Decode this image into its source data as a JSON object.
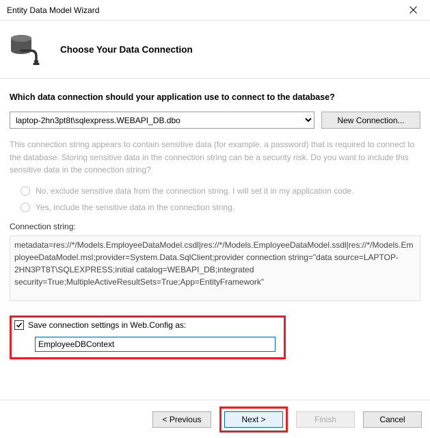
{
  "window": {
    "title": "Entity Data Model Wizard"
  },
  "header": {
    "title": "Choose Your Data Connection"
  },
  "prompt": "Which data connection should your application use to connect to the database?",
  "connection": {
    "selected": "laptop-2hn3pt8t\\sqlexpress.WEBAPI_DB.dbo",
    "new_button": "New Connection..."
  },
  "sensitive": {
    "explain": "This connection string appears to contain sensitive data (for example, a password) that is required to connect to the database. Storing sensitive data in the connection string can be a security risk. Do you want to include this sensitive data in the connection string?",
    "no_label": "No, exclude sensitive data from the connection string. I will set it in my application code.",
    "yes_label": "Yes, include the sensitive data in the connection string."
  },
  "connstring": {
    "label": "Connection string:",
    "value": "metadata=res://*/Models.EmployeeDataModel.csdl|res://*/Models.EmployeeDataModel.ssdl|res://*/Models.EmployeeDataModel.msl;provider=System.Data.SqlClient;provider connection string=\"data source=LAPTOP-2HN3PT8T\\SQLEXPRESS;initial catalog=WEBAPI_DB;integrated security=True;MultipleActiveResultSets=True;App=EntityFramework\""
  },
  "save": {
    "checkbox_label": "Save connection settings in Web.Config as:",
    "checked": true,
    "value": "EmployeeDBContext"
  },
  "footer": {
    "previous": "< Previous",
    "next": "Next >",
    "finish": "Finish",
    "cancel": "Cancel"
  }
}
